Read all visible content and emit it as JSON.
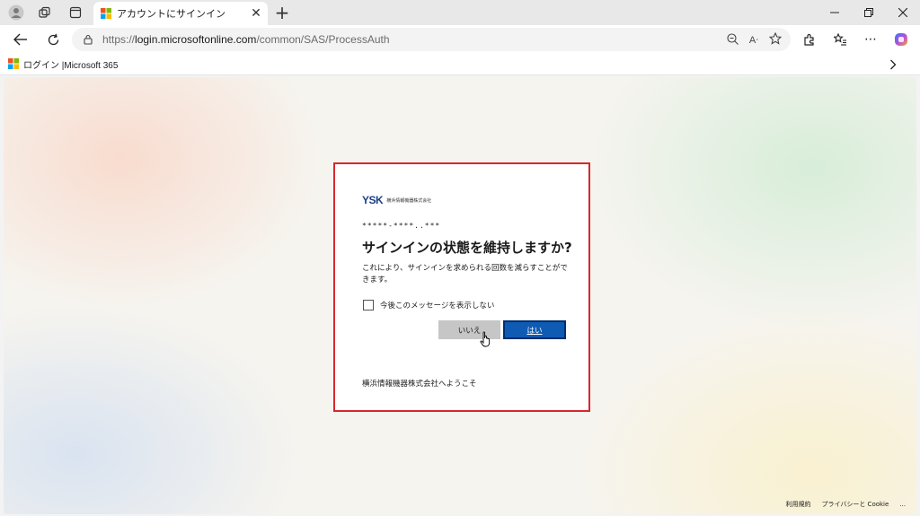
{
  "browser": {
    "tab": {
      "title": "アカウントにサインイン"
    },
    "address": {
      "prefix": "https://",
      "host": "login.microsoftonline.com",
      "path": "/common/SAS/ProcessAuth"
    },
    "favorites": [
      {
        "label": "ログイン |Microsoft 365"
      }
    ]
  },
  "dialog": {
    "logo_text": "YSK",
    "company_name_small": "横浜情報機器株式会社",
    "account_masked": "*****-****..***",
    "heading": "サインインの状態を維持しますか?",
    "description": "これにより、サインインを求められる回数を減らすことができます。",
    "checkbox_label": "今後このメッセージを表示しない",
    "checkbox_checked": false,
    "no_button": "いいえ",
    "yes_button": "はい",
    "welcome": "横浜情報機器株式会社へようこそ"
  },
  "footer": {
    "terms": "利用規約",
    "privacy": "プライバシーと Cookie",
    "more": "..."
  },
  "colors": {
    "highlight_border": "#d9262c",
    "primary_button": "#0f5bb4",
    "secondary_button": "#c6c6c6"
  }
}
